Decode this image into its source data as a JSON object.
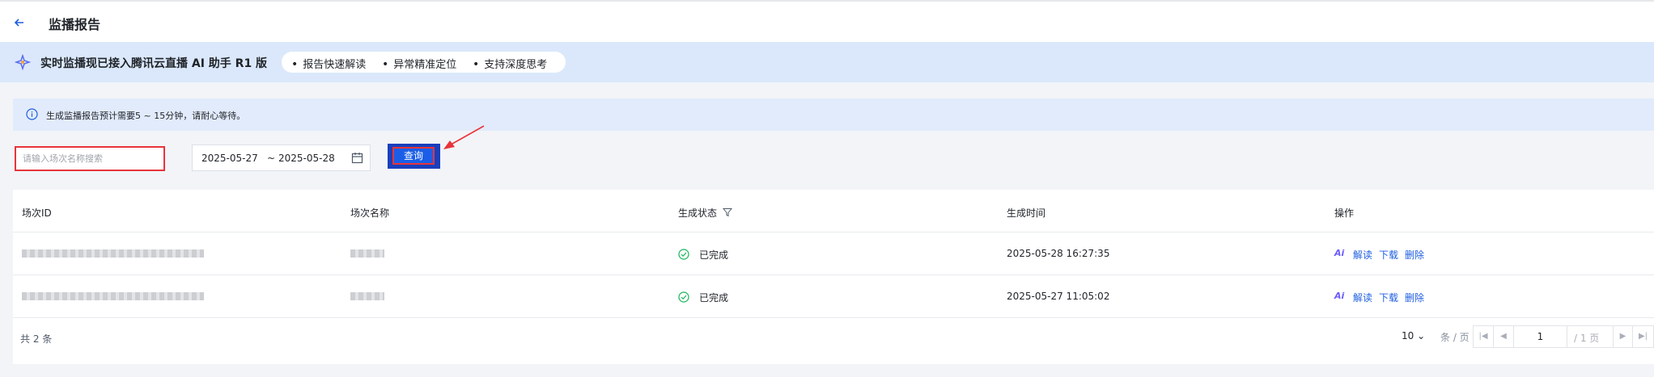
{
  "header": {
    "back_icon": "arrow-left-icon",
    "title": "监播报告"
  },
  "banner": {
    "text": "实时监播现已接入腾讯云直播 AI 助手 R1 版",
    "features": [
      "报告快速解读",
      "异常精准定位",
      "支持深度思考"
    ]
  },
  "notice": {
    "text": "生成监播报告预计需要5 ~ 15分钟，请耐心等待。"
  },
  "filters": {
    "search_placeholder": "请输入场次名称搜索",
    "date_start": "2025-05-27",
    "date_separator": "~",
    "date_end": "2025-05-28",
    "query_label": "查询"
  },
  "table": {
    "columns": [
      "场次ID",
      "场次名称",
      "生成状态",
      "生成时间",
      "操作"
    ],
    "rows": [
      {
        "status": "已完成",
        "time": "2025-05-28 16:27:35"
      },
      {
        "status": "已完成",
        "time": "2025-05-27 11:05:02"
      }
    ],
    "ops": {
      "ai": "Ai",
      "interpret": "解读",
      "download": "下载",
      "delete": "删除"
    }
  },
  "footer": {
    "total": "共 2 条",
    "page_size": "10",
    "per_page": "条 / 页",
    "current_page": "1",
    "total_pages": "/ 1 页"
  },
  "colors": {
    "primary": "#1a5ee8",
    "success": "#18b35a",
    "highlight": "#e8343a"
  }
}
